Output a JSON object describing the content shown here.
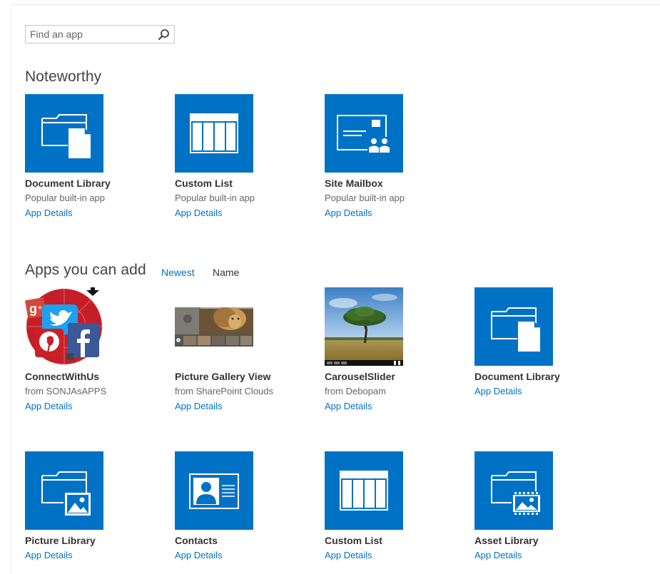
{
  "search": {
    "placeholder": "Find an app"
  },
  "noteworthy": {
    "heading": "Noteworthy",
    "tiles": [
      {
        "title": "Document Library",
        "subtitle": "Popular built-in app",
        "link": "App Details",
        "icon": "document-library-icon"
      },
      {
        "title": "Custom List",
        "subtitle": "Popular built-in app",
        "link": "App Details",
        "icon": "custom-list-icon"
      },
      {
        "title": "Site Mailbox",
        "subtitle": "Popular built-in app",
        "link": "App Details",
        "icon": "site-mailbox-icon"
      }
    ]
  },
  "apps": {
    "heading": "Apps you can add",
    "sort": {
      "newest": "Newest",
      "name": "Name"
    },
    "tiles": [
      {
        "title": "ConnectWithUs",
        "subtitle": "from SONJAsAPPS",
        "link": "App Details",
        "icon": "social-media-logo"
      },
      {
        "title": "Picture Gallery View",
        "subtitle": "from SharePoint Clouds",
        "link": "App Details",
        "icon": "picture-gallery-thumbnail"
      },
      {
        "title": "CarouselSlider",
        "subtitle": "from Debopam",
        "link": "App Details",
        "icon": "carousel-tree-thumbnail"
      },
      {
        "title": "Document Library",
        "subtitle": "",
        "link": "App Details",
        "icon": "document-library-icon"
      },
      {
        "title": "Picture Library",
        "subtitle": "",
        "link": "App Details",
        "icon": "picture-library-icon"
      },
      {
        "title": "Contacts",
        "subtitle": "",
        "link": "App Details",
        "icon": "contacts-icon"
      },
      {
        "title": "Custom List",
        "subtitle": "",
        "link": "App Details",
        "icon": "custom-list-icon"
      },
      {
        "title": "Asset Library",
        "subtitle": "",
        "link": "App Details",
        "icon": "asset-library-icon"
      }
    ]
  },
  "colors": {
    "tile_blue": "#0072c6",
    "link_blue": "#0072c6",
    "heading": "#444444"
  }
}
